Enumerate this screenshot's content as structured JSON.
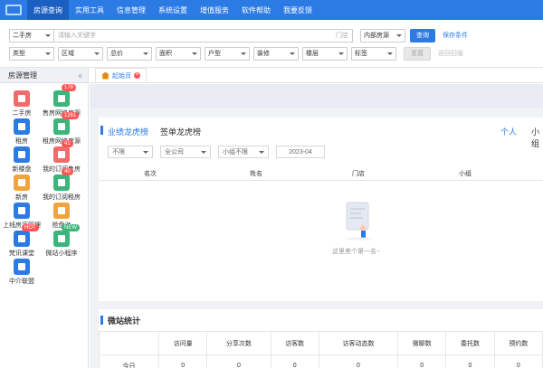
{
  "nav": {
    "items": [
      "房源查询",
      "实用工具",
      "信息管理",
      "系统设置",
      "增值服务",
      "软件帮助",
      "我要反馈"
    ],
    "active_index": 0
  },
  "search": {
    "type_select": "二手房",
    "keyword_placeholder": "请输入关键字",
    "store_label": "门店",
    "scope_select": "内部房源",
    "query_button": "查询",
    "save_condition": "保存条件",
    "filters": [
      "类型",
      "区域",
      "总价",
      "面积",
      "户型",
      "装修",
      "楼层",
      "标签"
    ],
    "reset_button": "重置",
    "back_link": "返回旧版"
  },
  "sidebar": {
    "title": "房源管理",
    "collapse": "«",
    "items": [
      {
        "label": "二手房",
        "icon": "house-icon",
        "color": "#f16b6b",
        "badge": ""
      },
      {
        "label": "售房网络房源",
        "icon": "network-house-icon",
        "color": "#3bb57a",
        "badge": "178"
      },
      {
        "label": "租房",
        "icon": "rent-icon",
        "color": "#2c7be5",
        "badge": ""
      },
      {
        "label": "租房网络房源",
        "icon": "rent-network-icon",
        "color": "#3bb57a",
        "badge": "1261"
      },
      {
        "label": "新楼盘",
        "icon": "building-icon",
        "color": "#2c7be5",
        "badge": ""
      },
      {
        "label": "我的订阅售房",
        "icon": "subscribe-sale-icon",
        "color": "#f16b6b",
        "badge": "41"
      },
      {
        "label": "新房",
        "icon": "new-house-icon",
        "color": "#f3a33b",
        "badge": ""
      },
      {
        "label": "我的订阅租房",
        "icon": "subscribe-rent-icon",
        "color": "#3bb57a",
        "badge": "40"
      },
      {
        "label": "上线房源管理",
        "icon": "online-icon",
        "color": "#2c7be5",
        "badge": ""
      },
      {
        "label": "抢盘池",
        "icon": "grab-icon",
        "color": "#f3a33b",
        "badge": ""
      },
      {
        "label": "梵讯课堂",
        "icon": "classroom-icon",
        "color": "#2c7be5",
        "badge": "HOT"
      },
      {
        "label": "微站小程序",
        "icon": "miniapp-icon",
        "color": "#3bb57a",
        "badge": "NEW"
      },
      {
        "label": "中介联盟",
        "icon": "alliance-icon",
        "color": "#2c7be5",
        "badge": ""
      }
    ]
  },
  "tabs": [
    {
      "label": "起始页"
    }
  ],
  "ranking": {
    "tab_active": "业绩龙虎榜",
    "tab_other": "签单龙虎榜",
    "scope_personal": "个人",
    "scope_group": "小组",
    "filters": [
      "不限",
      "全公司",
      "小组不限",
      "2023-04"
    ],
    "columns": [
      "名次",
      "姓名",
      "门店",
      "小组"
    ],
    "empty_text": "这里差个第一名~"
  },
  "stats": {
    "title": "微站统计",
    "columns": [
      "访问量",
      "分享次数",
      "访客数",
      "访客动态数",
      "微聊数",
      "委托数",
      "预约数"
    ],
    "rows": [
      {
        "label": "今日",
        "values": [
          "0",
          "0",
          "0",
          "0",
          "0",
          "0",
          "0"
        ]
      }
    ]
  }
}
